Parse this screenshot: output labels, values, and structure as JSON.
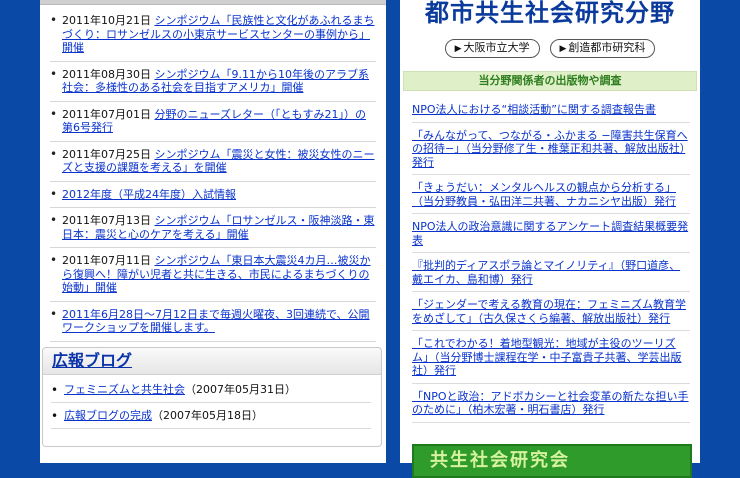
{
  "news": [
    {
      "date": "2011年10月21日",
      "text": "シンポジウム「民族性と文化があふれるまちづくり：ロサンゼルスの小東京サービスセンターの事例から」開催"
    },
    {
      "date": "2011年08月30日",
      "text": "シンポジウム「9.11から10年後のアラブ系社会：多様性のある社会を目指すアメリカ」開催"
    },
    {
      "date": "2011年07月01日",
      "text": "分野のニューズレター（「ともすみ21」）の第6号発行"
    },
    {
      "date": "2011年07月25日",
      "text": "シンポジウム「震災と女性：被災女性のニーズと支援の課題を考える」を開催"
    },
    {
      "date": "",
      "text": "2012年度（平成24年度）入試情報"
    },
    {
      "date": "2011年07月13日",
      "text": "シンポジウム「ロサンゼルス・阪神淡路・東日本：震災と心のケアを考える」開催"
    },
    {
      "date": "2011年07月11日",
      "text": "シンポジウム「東日本大震災4カ月…被災から復興へ！障がい児者と共に生きる、市民によるまちづくりの始動」開催"
    },
    {
      "date": "",
      "text": "2011年6月28日〜7月12日まで毎週火曜夜、3回連続で、公開ワークショップを開催します。"
    }
  ],
  "blog": {
    "title": "広報ブログ",
    "items": [
      {
        "link": "フェミニズムと共生社会",
        "date": "（2007年05月31日）"
      },
      {
        "link": "広報ブログの完成",
        "date": "（2007年05月18日）"
      }
    ]
  },
  "header": {
    "title": "都市共生社会研究分野",
    "link1": "大阪市立大学",
    "link2": "創造都市研究科"
  },
  "pubs": {
    "heading": "当分野関係者の出版物や調査",
    "items": [
      "NPO法人における“相談活動”に関する調査報告書",
      "「みんながって、つながる・ふかまる −障害共生保育への招待−」（当分野修了生・椎葉正和共著、解放出版社）発行",
      "「きょうだい：メンタルヘルスの観点から分析する」（当分野教員・弘田洋二共著、ナカニシヤ出版）発行",
      "NPO法人の政治意識に関するアンケート調査結果概要発表",
      "『批判的ディアスポラ論とマイノリティ』（野口道彦、戴エイカ、島和博）発行",
      "「ジェンダーで考える教育の現在：フェミニズム教育学をめざして」（古久保さくら編著、解放出版社）発行",
      "「これでわかる！着地型観光：地域が主役のツーリズム」（当分野博士課程在学・中子富貴子共著、学芸出版社）発行",
      "「NPOと政治：アドボカシーと社会変革の新たな担い手のために」（柏木宏著・明石書店）発行"
    ]
  },
  "banner": {
    "text": "共生社会研究会"
  }
}
